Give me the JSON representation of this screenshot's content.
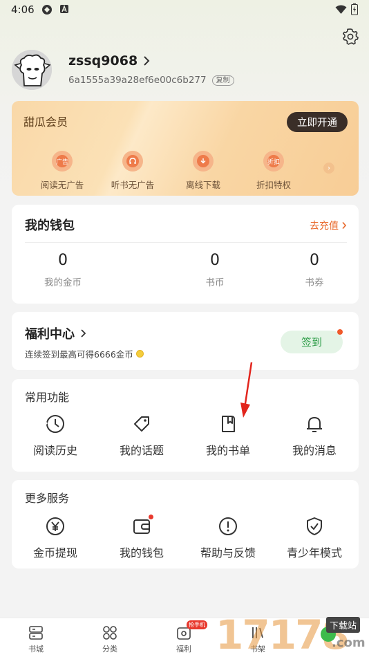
{
  "status_bar": {
    "time": "4:06"
  },
  "profile": {
    "username": "zssq9068",
    "user_id": "6a1555a39a28ef6e00c6b277",
    "copy_label": "复制"
  },
  "vip": {
    "title": "甜瓜会员",
    "open_button": "立即开通",
    "benefits": [
      {
        "label": "阅读无广告",
        "icon_text": "广告"
      },
      {
        "label": "听书无广告",
        "icon_text": ""
      },
      {
        "label": "离线下载",
        "icon_text": ""
      },
      {
        "label": "折扣特权",
        "icon_text": "折扣"
      }
    ]
  },
  "wallet": {
    "title": "我的钱包",
    "recharge": "去充值",
    "items": [
      {
        "value": "0",
        "label": "我的金币"
      },
      {
        "value": "0",
        "label": "书币"
      },
      {
        "value": "0",
        "label": "书券"
      }
    ]
  },
  "welfare": {
    "title": "福利中心",
    "subtitle": "连续签到最高可得6666金币",
    "signin": "签到"
  },
  "common": {
    "title": "常用功能",
    "items": [
      {
        "label": "阅读历史",
        "icon": "history-icon"
      },
      {
        "label": "我的话题",
        "icon": "tag-icon"
      },
      {
        "label": "我的书单",
        "icon": "booklist-icon"
      },
      {
        "label": "我的消息",
        "icon": "bell-icon"
      }
    ]
  },
  "more": {
    "title": "更多服务",
    "items": [
      {
        "label": "金币提现",
        "icon": "yuan-icon"
      },
      {
        "label": "我的钱包",
        "icon": "wallet-icon"
      },
      {
        "label": "帮助与反馈",
        "icon": "help-icon"
      },
      {
        "label": "青少年模式",
        "icon": "shield-icon"
      }
    ]
  },
  "bottom_nav": {
    "items": [
      {
        "label": "书城"
      },
      {
        "label": "分类"
      },
      {
        "label": "福利",
        "badge": "抢手机"
      },
      {
        "label": "书架"
      }
    ]
  },
  "watermark": {
    "number": "17178",
    "tag": "下载站",
    "domain": ".com"
  },
  "colors": {
    "accent": "#e8672a",
    "green": "#2c9b46",
    "vip_dark": "#3a2e28"
  }
}
